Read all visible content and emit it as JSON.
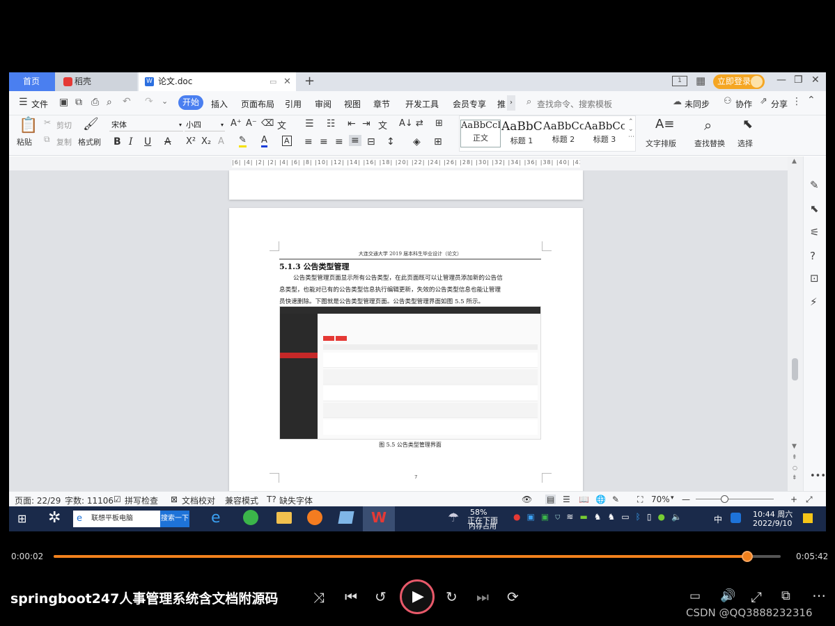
{
  "tabs": {
    "home": "首页",
    "daoke": "稻壳",
    "doc": "论文.doc"
  },
  "titlebar": {
    "login": "立即登录"
  },
  "menu": {
    "file": "文件",
    "start": "开始",
    "insert": "插入",
    "layout": "页面布局",
    "reference": "引用",
    "review": "审阅",
    "view": "视图",
    "chapter": "章节",
    "devtools": "开发工具",
    "member": "会员专享",
    "more": "推",
    "search_placeholder": "查找命令、搜索模板",
    "sync": "未同步",
    "collab": "协作",
    "share": "分享"
  },
  "ribbon": {
    "paste": "粘贴",
    "cut": "剪切",
    "copy": "复制",
    "format_painter": "格式刷",
    "font_name": "宋体",
    "font_size": "小四",
    "styles": [
      {
        "sample": "AaBbCcI",
        "label": "正文"
      },
      {
        "sample": "AaBbC",
        "label": "标题 1"
      },
      {
        "sample": "AaBbCc",
        "label": "标题 2"
      },
      {
        "sample": "AaBbCc",
        "label": "标题 3"
      }
    ],
    "text_layout": "文字排版",
    "find_replace": "查找替换",
    "select": "选择"
  },
  "ruler": {
    "ticks": "|6| |4| |2| |2| |4| |6| |8| |10| |12| |14| |16| |18| |20| |22| |24| |26| |28| |30| |32| |34| |36| |38| |40| |42|"
  },
  "document": {
    "header": "大连交通大学 2019 届本科生毕业设计（论文）",
    "section_heading": "5.1.3  公告类型管理",
    "paragraph_line1": "公告类型管理页面显示所有公告类型，在此页面既可以让管理员添加新的公告信",
    "paragraph_line2": "息类型，也能对已有的公告类型信息执行编辑更新，失效的公告类型信息也能让管理",
    "paragraph_line3": "员快速删除。下图就是公告类型管理页面。公告类型管理界面如图 5.5 所示。",
    "figure_caption": "图 5.5 公告类型管理界面",
    "page_number": "7"
  },
  "statusbar": {
    "page": "页面: 22/29",
    "words": "字数: 11106",
    "spellcheck": "拼写检查",
    "proofread": "文档校对",
    "compat": "兼容模式",
    "missing_font": "缺失字体",
    "zoom": "70%"
  },
  "taskbar": {
    "search_text": "联想平板电脑",
    "search_button": "搜索一下",
    "weather_temp": "58%",
    "weather_status": "正在下雨",
    "memory": "内存占用",
    "ime": "中",
    "time": "10:44 周六",
    "date": "2022/9/10"
  },
  "player": {
    "current_time": "0:00:02",
    "total_time": "0:05:42",
    "progress_fraction": 0.954,
    "title": "springboot247人事管理系统含文档附源码",
    "watermark": "CSDN @QQ3888232316"
  },
  "colors": {
    "accent": "#4a7ff0",
    "progress": "#f2811d",
    "login": "#f5a623"
  }
}
